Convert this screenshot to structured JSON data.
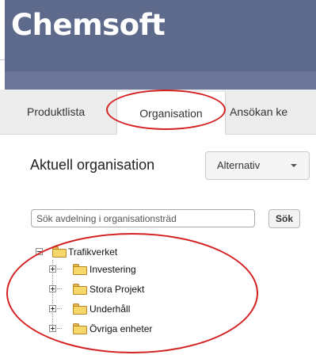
{
  "header": {
    "brand": "Chemsoft",
    "color": "#5e6a8c"
  },
  "tabs": [
    {
      "label": "Produktlista"
    },
    {
      "label": "Organisation",
      "active": true
    },
    {
      "label": "Ansökan ke"
    }
  ],
  "main": {
    "title": "Aktuell organisation",
    "options_button": "Alternativ",
    "search": {
      "placeholder": "Sök avdelning i organisationsträd",
      "value": "",
      "button": "Sök"
    },
    "tree": {
      "root": {
        "label": "Trafikverket",
        "expanded": true
      },
      "children": [
        {
          "label": "Investering",
          "expanded": false
        },
        {
          "label": "Stora Projekt",
          "expanded": false
        },
        {
          "label": "Underhåll",
          "expanded": false
        },
        {
          "label": "Övriga enheter",
          "expanded": false
        }
      ]
    }
  },
  "annotations": {
    "highlight_color": "#d42020"
  }
}
